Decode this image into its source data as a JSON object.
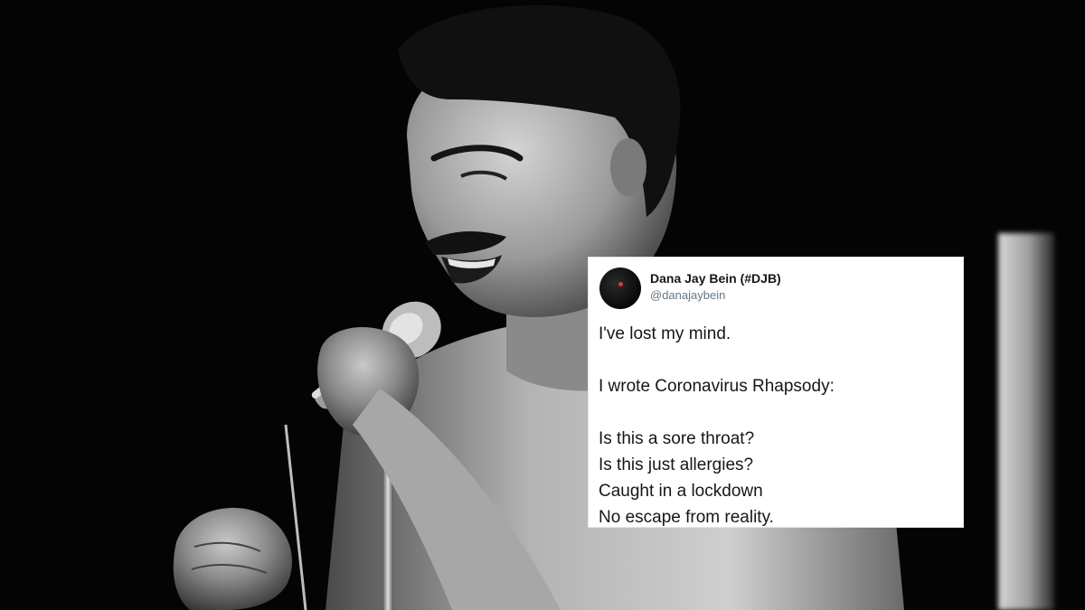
{
  "tweet": {
    "author_name": "Dana Jay Bein (#DJB)",
    "author_handle": "@danajaybein",
    "lines": [
      "I've lost my mind.",
      "I wrote Coronavirus Rhapsody:",
      "Is this a sore throat?",
      "Is this just allergies?",
      "Caught in a lockdown",
      "No escape from reality."
    ]
  },
  "photo": {
    "subject": "black-and-white photo of a shirtless singer with a moustache singing into a microphone on a stand, fist raised"
  }
}
